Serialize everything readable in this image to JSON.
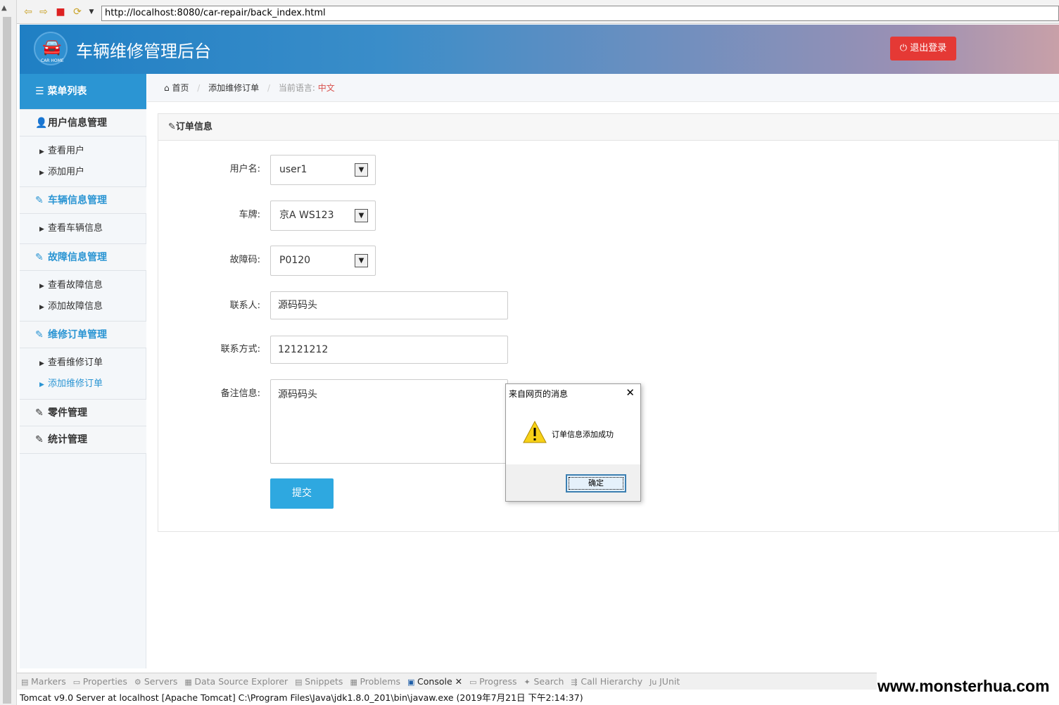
{
  "browser": {
    "url": "http://localhost:8080/car-repair/back_index.html"
  },
  "header": {
    "logo_text": "CAR HOME",
    "title": "车辆维修管理后台",
    "logout_label": "退出登录"
  },
  "sidebar": {
    "menu_title": "菜单列表",
    "groups": {
      "user": {
        "label": "用户信息管理",
        "items": [
          "查看用户",
          "添加用户"
        ]
      },
      "vehicle": {
        "label": "车辆信息管理",
        "items": [
          "查看车辆信息"
        ]
      },
      "fault": {
        "label": "故障信息管理",
        "items": [
          "查看故障信息",
          "添加故障信息"
        ]
      },
      "order": {
        "label": "维修订单管理",
        "items": [
          "查看维修订单",
          "添加维修订单"
        ]
      },
      "parts": {
        "label": "零件管理"
      },
      "stats": {
        "label": "统计管理"
      }
    }
  },
  "breadcrumb": {
    "home": "首页",
    "current": "添加维修订单",
    "lang_label": "当前语言:",
    "lang_value": "中文"
  },
  "panel": {
    "title": "订单信息"
  },
  "form": {
    "username": {
      "label": "用户名:",
      "value": "user1"
    },
    "plate": {
      "label": "车牌:",
      "value": "京A WS123"
    },
    "fault_code": {
      "label": "故障码:",
      "value": "P0120"
    },
    "contact": {
      "label": "联系人:",
      "value": "源码码头"
    },
    "phone": {
      "label": "联系方式:",
      "value": "12121212"
    },
    "remark": {
      "label": "备注信息:",
      "value": "源码码头"
    },
    "submit_label": "提交"
  },
  "dialog": {
    "title": "来自网页的消息",
    "message": "订单信息添加成功",
    "ok_label": "确定"
  },
  "eclipse": {
    "tabs": [
      "Markers",
      "Properties",
      "Servers",
      "Data Source Explorer",
      "Snippets",
      "Problems",
      "Console",
      "Progress",
      "Search",
      "Call Hierarchy",
      "JUnit"
    ],
    "status": "Tomcat v9.0 Server at localhost [Apache Tomcat] C:\\Program Files\\Java\\jdk1.8.0_201\\bin\\javaw.exe (2019年7月21日 下午2:14:37)"
  },
  "watermark": "www.monsterhua.com",
  "colors": {
    "accent": "#2b95d3",
    "logout": "#e53935",
    "submit": "#2ea8e0"
  }
}
